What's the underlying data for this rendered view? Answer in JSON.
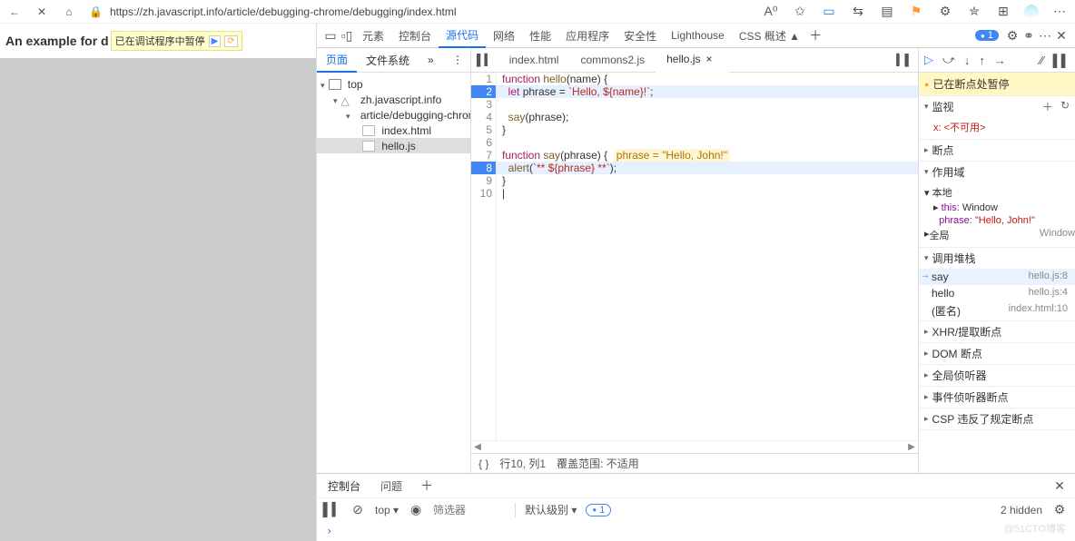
{
  "url": "https://zh.javascript.info/article/debugging-chrome/debugging/index.html",
  "page": {
    "heading_prefix": "An example for d",
    "badge": "已在调试程序中暂停"
  },
  "devtools_tabs": {
    "elements": "元素",
    "console": "控制台",
    "sources": "源代码",
    "network": "网络",
    "performance": "性能",
    "application": "应用程序",
    "security": "安全性",
    "lighthouse": "Lighthouse",
    "css_overview": "CSS 概述 ▲"
  },
  "error_count": "1",
  "nav": {
    "page": "页面",
    "filesystem": "文件系统"
  },
  "tree": {
    "top": "top",
    "domain": "zh.javascript.info",
    "folder": "article/debugging-chrome/de",
    "index": "index.html",
    "hello": "hello.js"
  },
  "open_tabs": {
    "index": "index.html",
    "commons": "commons2.js",
    "hello": "hello.js"
  },
  "code": {
    "l1": "function hello(name) {",
    "l2": "  let phrase = `Hello, ${name}!`;",
    "l3": "",
    "l4": "  say(phrase);",
    "l5": "}",
    "l6": "",
    "l7a": "function say(phrase) {  ",
    "l7b": "phrase = \"Hello, John!\"",
    "l8": "  alert(`** ${phrase} **`);",
    "l9": "}",
    "l10": ""
  },
  "status": {
    "brackets": "{ }",
    "pos": "行10, 列1",
    "coverage": "覆盖范围: 不适用"
  },
  "side": {
    "paused": "已在断点处暂停",
    "watch": "监视",
    "watch_item": "x: <不可用>",
    "breakpoints": "断点",
    "scope": "作用域",
    "local": "本地",
    "this_k": "this:",
    "this_v": " Window",
    "phrase_k": "phrase:",
    "phrase_v": " \"Hello, John!\"",
    "global": "全局",
    "global_v": "Window",
    "callstack": "调用堆栈",
    "cs1": "say",
    "cs1l": "hello.js:8",
    "cs2": "hello",
    "cs2l": "hello.js:4",
    "cs3": "(匿名)",
    "cs3l": "index.html:10",
    "xhr": "XHR/提取断点",
    "dom": "DOM 断点",
    "gl": "全局侦听器",
    "ev": "事件侦听器断点",
    "csp": "CSP 违反了规定断点"
  },
  "drawer": {
    "console": "控制台",
    "issues": "问题",
    "top": "top",
    "filter_ph": "筛选器",
    "level": "默认级别",
    "count": "1",
    "hidden": "2 hidden"
  },
  "watermark": "@51CTO博客"
}
